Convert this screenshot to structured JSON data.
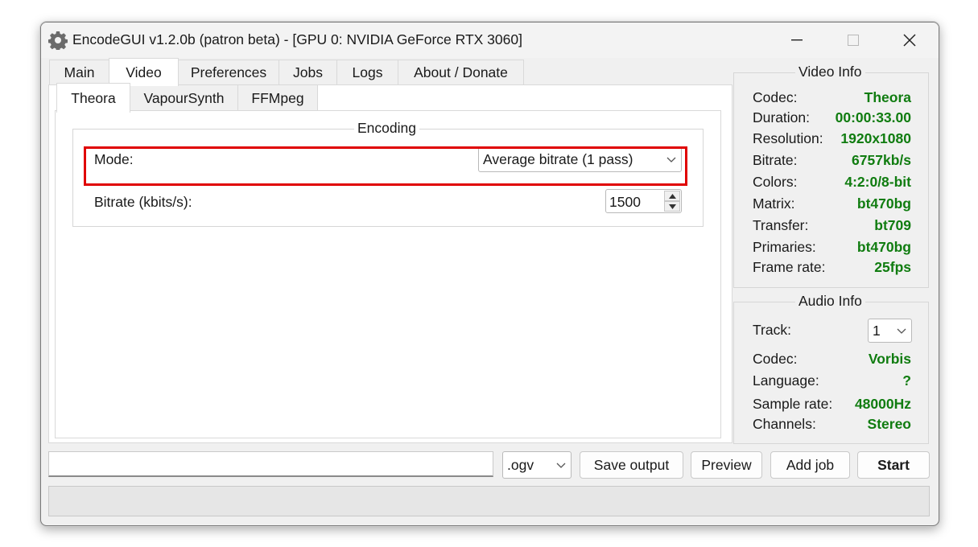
{
  "window": {
    "title": "EncodeGUI v1.2.0b (patron beta) - [GPU 0: NVIDIA GeForce RTX 3060]",
    "icon": "gear-icon"
  },
  "main_tabs": [
    "Main",
    "Video",
    "Preferences",
    "Jobs",
    "Logs",
    "About / Donate"
  ],
  "active_main_tab": "Video",
  "sub_tabs": [
    "Theora",
    "VapourSynth",
    "FFMpeg"
  ],
  "active_sub_tab": "Theora",
  "encoding": {
    "title": "Encoding",
    "mode_label": "Mode:",
    "mode_value": "Average bitrate (1 pass)",
    "bitrate_label": "Bitrate (kbits/s):",
    "bitrate_value": "1500"
  },
  "video_info": {
    "title": "Video Info",
    "rows": [
      {
        "key": "Codec:",
        "value": "Theora"
      },
      {
        "key": "Duration:",
        "value": "00:00:33.00"
      },
      {
        "key": "Resolution:",
        "value": "1920x1080"
      },
      {
        "key": "Bitrate:",
        "value": "6757kb/s"
      },
      {
        "key": "Colors:",
        "value": "4:2:0/8-bit"
      },
      {
        "key": "Matrix:",
        "value": "bt470bg"
      },
      {
        "key": "Transfer:",
        "value": "bt709"
      },
      {
        "key": "Primaries:",
        "value": "bt470bg"
      },
      {
        "key": "Frame rate:",
        "value": "25fps"
      }
    ]
  },
  "audio_info": {
    "title": "Audio Info",
    "track_label": "Track:",
    "track_value": "1",
    "rows": [
      {
        "key": "Codec:",
        "value": "Vorbis"
      },
      {
        "key": "Language:",
        "value": "?"
      },
      {
        "key": "Sample rate:",
        "value": "48000Hz"
      },
      {
        "key": "Channels:",
        "value": "Stereo"
      }
    ]
  },
  "bottom": {
    "output_path": "",
    "extension": ".ogv",
    "save_output": "Save output",
    "preview": "Preview",
    "add_job": "Add job",
    "start": "Start"
  },
  "colors": {
    "info_value": "#107c10",
    "highlight": "#e00000"
  }
}
